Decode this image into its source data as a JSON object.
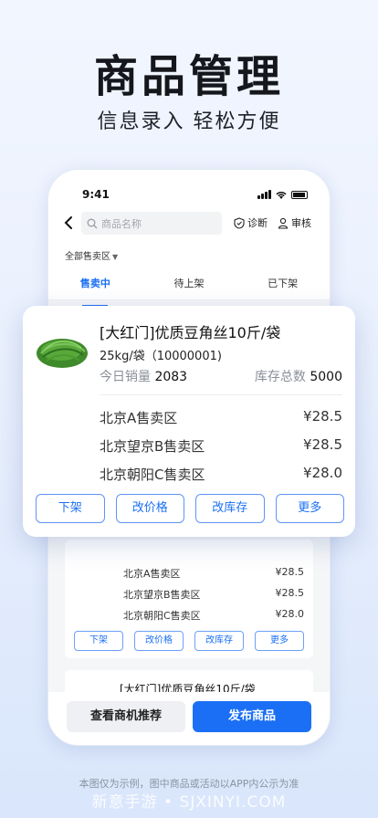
{
  "hero": {
    "title": "商品管理",
    "subtitle": "信息录入 轻松方便"
  },
  "status_bar": {
    "time": "9:41"
  },
  "nav": {
    "search_placeholder": "商品名称",
    "diagnose_label": "诊断",
    "audit_label": "审核"
  },
  "filter": {
    "label": "全部售卖区"
  },
  "tabs": [
    {
      "label": "售卖中",
      "active": true
    },
    {
      "label": "待上架",
      "active": false
    },
    {
      "label": "已下架",
      "active": false
    }
  ],
  "product_popup": {
    "title": "[大红门]优质豆角丝10斤/袋",
    "spec": "25kg/袋（10000001)",
    "sales_label": "今日销量",
    "sales_value": "2083",
    "stock_label": "库存总数",
    "stock_value": "5000",
    "areas": [
      {
        "name": "北京A售卖区",
        "price": "¥28.5"
      },
      {
        "name": "北京望京B售卖区",
        "price": "¥28.5"
      },
      {
        "name": "北京朝阳C售卖区",
        "price": "¥28.0"
      }
    ],
    "buttons": [
      "下架",
      "改价格",
      "改库存",
      "更多"
    ]
  },
  "background_card": {
    "areas": [
      {
        "name": "北京A售卖区",
        "price": "¥28.5"
      },
      {
        "name": "北京望京B售卖区",
        "price": "¥28.5"
      },
      {
        "name": "北京朝阳C售卖区",
        "price": "¥28.0"
      }
    ],
    "buttons": [
      "下架",
      "改价格",
      "改库存",
      "更多"
    ]
  },
  "second_card": {
    "title": "[大红门]优质豆角丝10斤/袋"
  },
  "bottom_bar": {
    "secondary_label": "查看商机推荐",
    "primary_label": "发布商品"
  },
  "disclaimer": "本图仅为示例，图中商品或活动以APP内公示为准",
  "watermark": "新意手游 • SJXINYI.COM",
  "colors": {
    "accent": "#1b6ff5"
  }
}
